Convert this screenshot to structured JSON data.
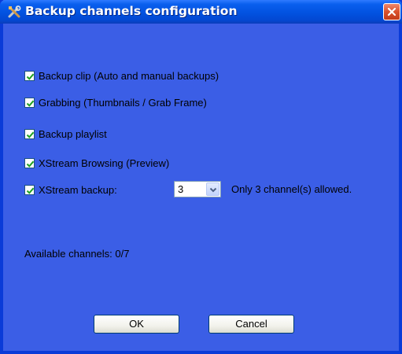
{
  "window": {
    "title": "Backup channels configuration",
    "accent": "#0252e0",
    "background": "#3b5ee6"
  },
  "options": [
    {
      "label": "Backup clip (Auto and manual backups)",
      "checked": true
    },
    {
      "label": "Grabbing (Thumbnails / Grab Frame)",
      "checked": true
    },
    {
      "label": "Backup playlist",
      "checked": true
    },
    {
      "label": "XStream Browsing (Preview)",
      "checked": true
    },
    {
      "label": "XStream backup:",
      "checked": true
    }
  ],
  "xstream_select": {
    "value": "3",
    "note": "Only 3 channel(s) allowed."
  },
  "available": "Available channels: 0/7",
  "buttons": {
    "ok": "OK",
    "cancel": "Cancel"
  },
  "icons": {
    "title": "tools-icon",
    "close": "close-icon",
    "check": "checkmark-icon",
    "dropdown": "chevron-down-icon"
  }
}
